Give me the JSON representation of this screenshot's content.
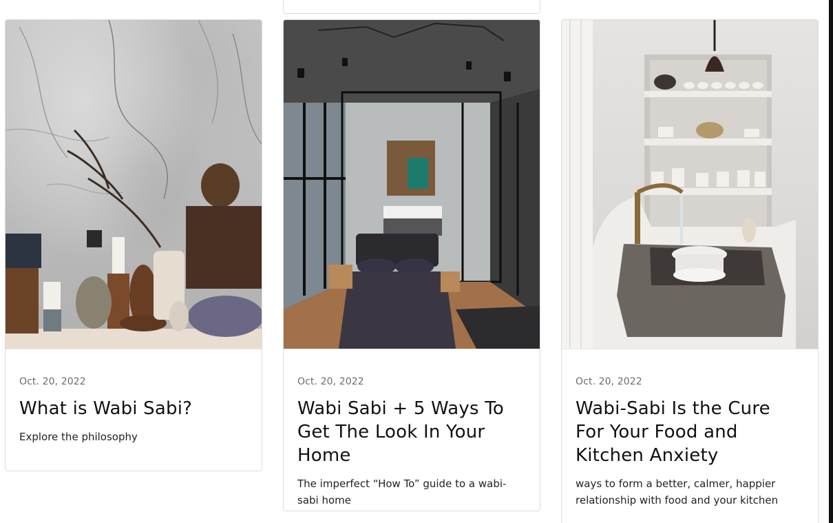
{
  "colors": {
    "card_border": "#dcdcdc",
    "date_text": "#6b6b6b",
    "title_text": "#111111"
  },
  "cards": [
    {
      "date": "Oct. 20, 2022",
      "title": "What is Wabi Sabi?",
      "description": "Explore the philosophy",
      "image": "marble-wall-still-life-image"
    },
    {
      "date": "Oct. 20, 2022",
      "title": "Wabi Sabi + 5 Ways To Get The Look In Your Home",
      "description": "The imperfect “How To” guide to a wabi-sabi home",
      "image": "dark-bedroom-image"
    },
    {
      "date": "Oct. 20, 2022",
      "title": "Wabi-Sabi Is the Cure For Your Food and Kitchen Anxiety",
      "description": "ways to form a better, calmer, happier relationship with food and your kitchen",
      "image": "stone-sink-kitchen-image"
    }
  ]
}
